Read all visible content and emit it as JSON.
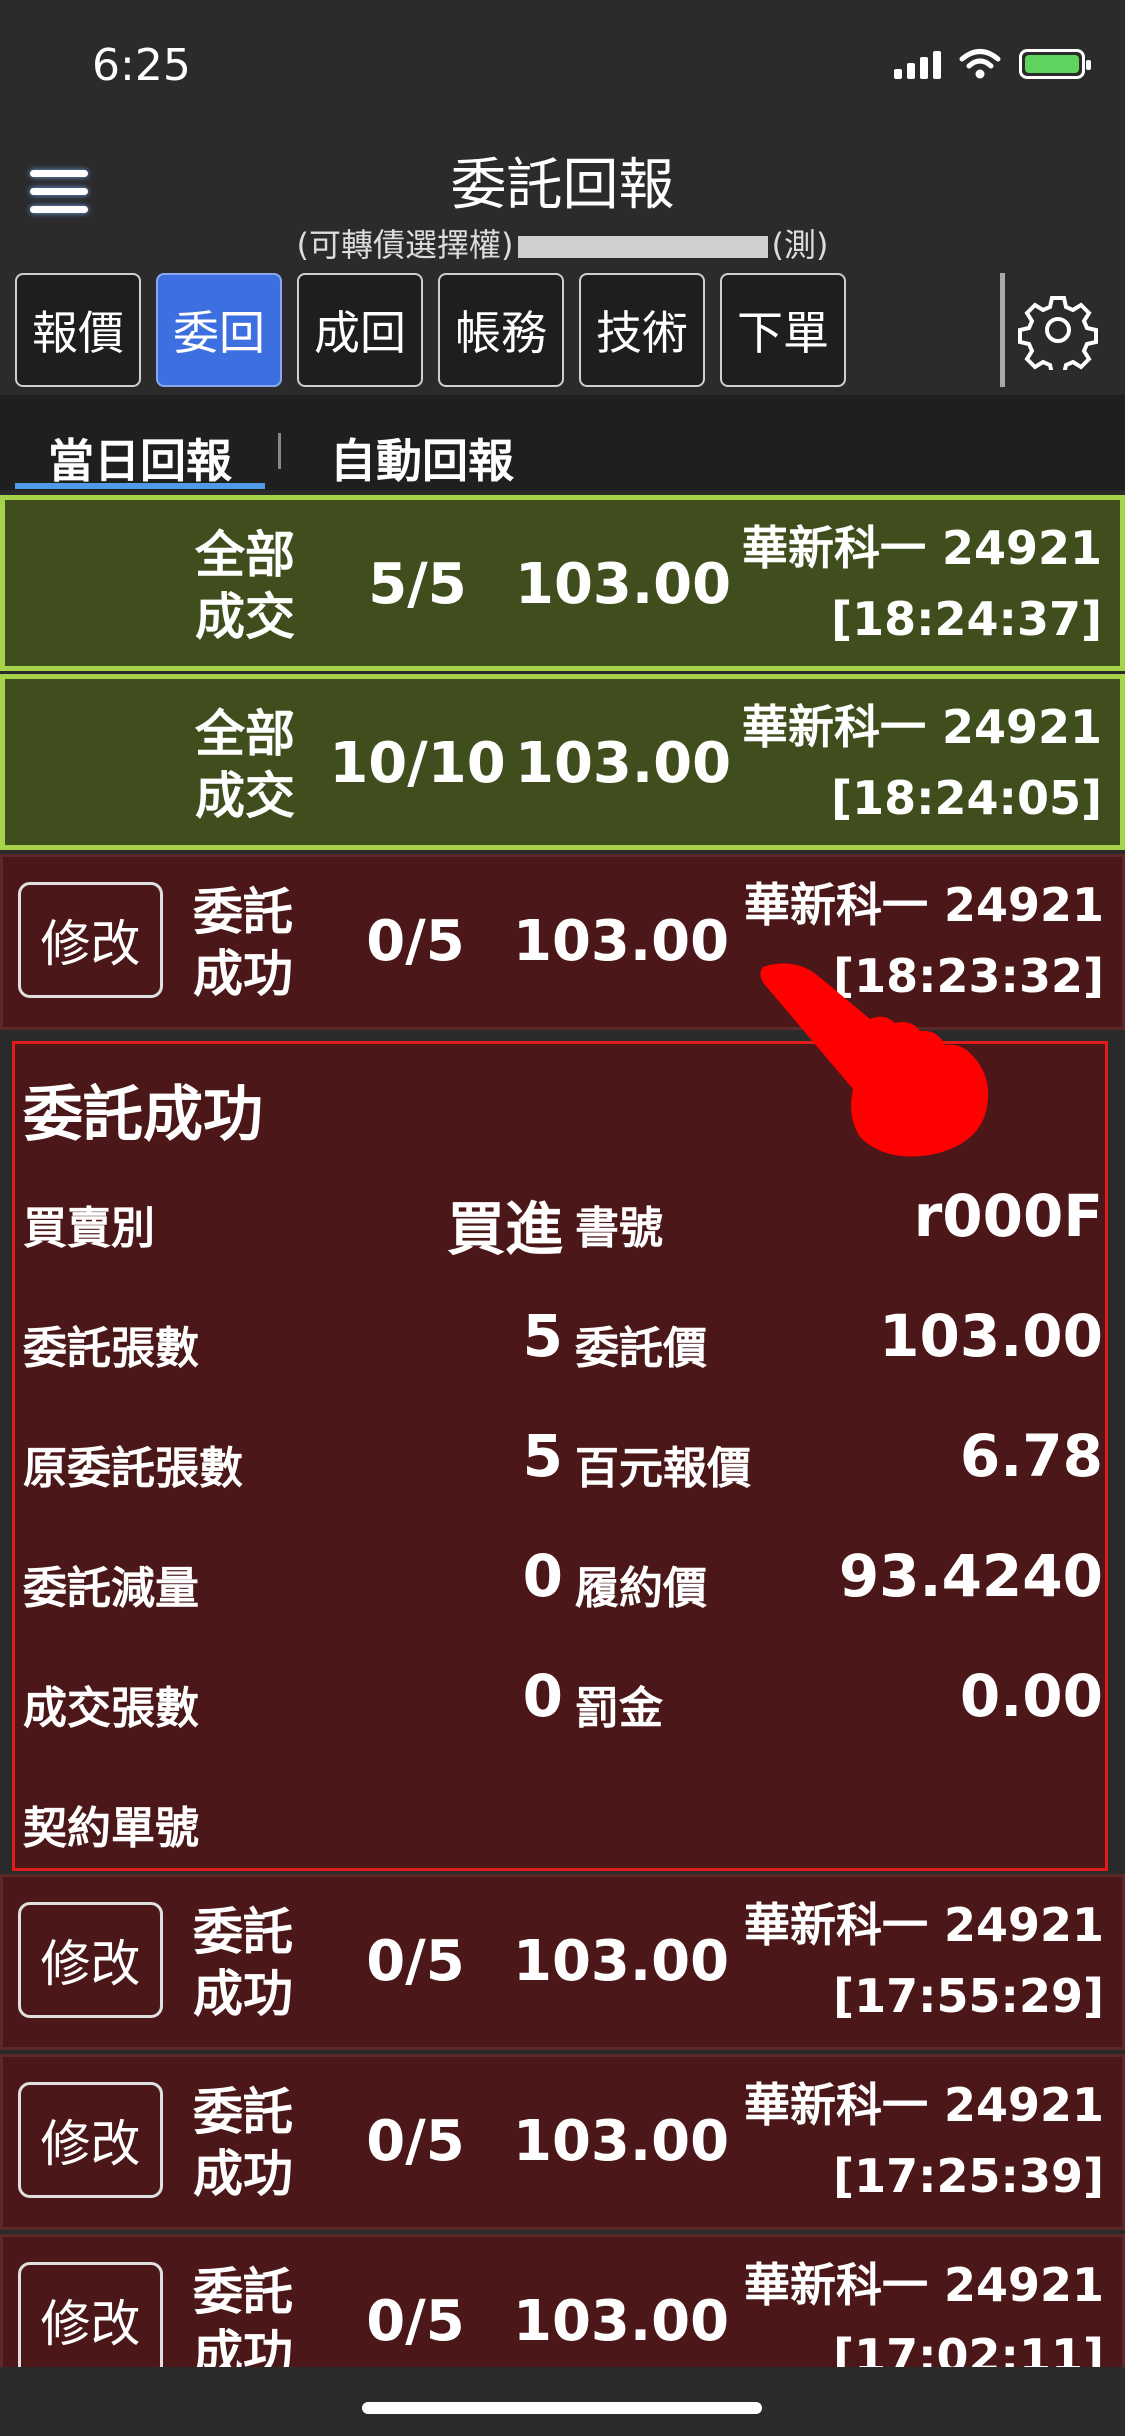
{
  "status_bar": {
    "time": "6:25"
  },
  "header": {
    "title": "委託回報",
    "subtitle_left": "(可轉債選擇權)",
    "subtitle_right": "(測)"
  },
  "toolbar": {
    "tabs": [
      "報價",
      "委回",
      "成回",
      "帳務",
      "技術",
      "下單"
    ],
    "active_tab": "委回"
  },
  "subtabs": [
    "當日回報",
    "自動回報"
  ],
  "orders": [
    {
      "status": "全部成交",
      "qty": "5/5",
      "price": "103.00",
      "symbol": "華新科一 24921",
      "time": "[18:24:37]",
      "type": "filled"
    },
    {
      "status": "全部成交",
      "qty": "10/10",
      "price": "103.00",
      "symbol": "華新科一 24921",
      "time": "[18:24:05]",
      "type": "filled"
    },
    {
      "status": "委託成功",
      "qty": "0/5",
      "price": "103.00",
      "symbol": "華新科一 24921",
      "time": "[18:23:32]",
      "type": "order",
      "modify": "修改"
    },
    {
      "status": "委託成功",
      "qty": "0/5",
      "price": "103.00",
      "symbol": "華新科一 24921",
      "time": "[17:55:29]",
      "type": "order",
      "modify": "修改"
    },
    {
      "status": "委託成功",
      "qty": "0/5",
      "price": "103.00",
      "symbol": "華新科一 24921",
      "time": "[17:25:39]",
      "type": "order",
      "modify": "修改"
    },
    {
      "status": "委託成功",
      "qty": "0/5",
      "price": "103.00",
      "symbol": "華新科一 24921",
      "time": "[17:02:11]",
      "type": "order",
      "modify": "修改"
    }
  ],
  "detail": {
    "title": "委託成功",
    "rows": [
      {
        "label1": "買賣別",
        "value1": "買進",
        "label2": "書號",
        "value2": "r000F"
      },
      {
        "label1": "委託張數",
        "value1": "5",
        "label2": "委託價",
        "value2": "103.00"
      },
      {
        "label1": "原委託張數",
        "value1": "5",
        "label2": "百元報價",
        "value2": "6.78"
      },
      {
        "label1": "委託減量",
        "value1": "0",
        "label2": "履約價",
        "value2": "93.4240"
      },
      {
        "label1": "成交張數",
        "value1": "0",
        "label2": "罰金",
        "value2": "0.00"
      },
      {
        "label1": "契約單號",
        "value1": "",
        "label2": "",
        "value2": ""
      }
    ]
  },
  "colors": {
    "filled_bg": "#404e1d",
    "filled_border": "#a6d34a",
    "order_bg": "#4b1718",
    "detail_border": "#e01c1c",
    "active_tab": "#3d6fe0",
    "pointer_hand": "#ff0000"
  },
  "icons": [
    "hamburger-menu-icon",
    "gear-icon",
    "pointer-hand-icon",
    "signal-icon",
    "wifi-icon",
    "battery-icon"
  ]
}
